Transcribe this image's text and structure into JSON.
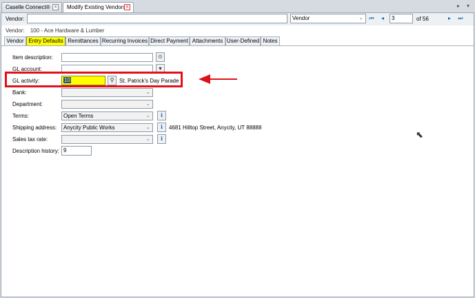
{
  "doc_tabs": [
    {
      "label": "Caselle Connect®",
      "active": false
    },
    {
      "label": "Modify Existing Vendors",
      "active": true
    }
  ],
  "search": {
    "label": "Vendor:",
    "value": "",
    "mode": "Vendor",
    "page": "3",
    "page_total": "of 56"
  },
  "vendor_info": {
    "label": "Vendor:",
    "value": "100  - Ace Hardware & Lumber"
  },
  "inner_tabs": [
    {
      "label": "Vendor",
      "active": false
    },
    {
      "label": "Entry Defaults",
      "active": true
    },
    {
      "label": "Remittances",
      "active": false
    },
    {
      "label": "Recurring Invoices",
      "active": false
    },
    {
      "label": "Direct Payment",
      "active": false
    },
    {
      "label": "Attachments",
      "active": false
    },
    {
      "label": "User-Defined",
      "active": false
    },
    {
      "label": "Notes",
      "active": false
    }
  ],
  "form": {
    "item_description": {
      "label": "Item description:",
      "value": ""
    },
    "gl_account": {
      "label": "GL account:",
      "value": ""
    },
    "gl_activity": {
      "label": "GL activity:",
      "value": "10",
      "description": "St. Patrick's Day Parade"
    },
    "bank": {
      "label": "Bank:",
      "value": ""
    },
    "department": {
      "label": "Department:",
      "value": ""
    },
    "terms": {
      "label": "Terms:",
      "value": "Open Terms"
    },
    "shipping_address": {
      "label": "Shipping address:",
      "value": "Anycity Public Works",
      "address": "4681 Hilltop Street, Anycity, UT 88888"
    },
    "sales_tax_rate": {
      "label": "Sales tax rate:",
      "value": ""
    },
    "description_history": {
      "label": "Description history:",
      "value": "9"
    }
  },
  "colors": {
    "highlight_yellow": "#ffff00",
    "annotation_red": "#e0101a",
    "link_blue": "#1c5fb8"
  }
}
